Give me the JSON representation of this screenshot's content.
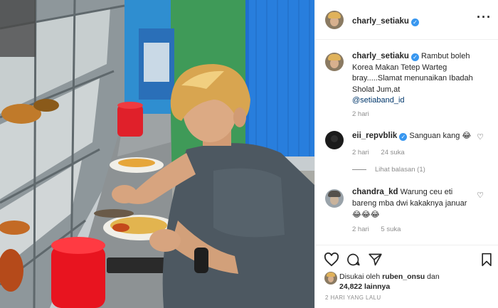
{
  "post": {
    "author": "charly_setiaku",
    "caption_text": "Rambut boleh Korea Makan Tetep Warteg bray.....Slamat menunaikan Ibadah Sholat Jum,at",
    "caption_mention": "@setiaband_id",
    "caption_time": "2 hari"
  },
  "comments": [
    {
      "user": "eii_repvblik",
      "text": "Sanguan kang",
      "emoji": "😂",
      "time": "2 hari",
      "likes": "24 suka",
      "replies_label": "Lihat balasan (1)"
    },
    {
      "user": "chandra_kd",
      "text": "Warung ceu eti bareng mba dwi kakaknya januar",
      "emoji": "😂😂😂",
      "time": "2 hari",
      "likes": "5 suka"
    }
  ],
  "likes": {
    "prefix": "Disukai oleh",
    "user": "ruben_onsu",
    "joiner": "dan",
    "count": "24,822",
    "suffix": "lainnya"
  },
  "post_date": "2 HARI YANG LALU",
  "icons": {
    "verified": "verified-badge-icon",
    "more": "more-options-icon",
    "like": "heart-icon",
    "comment": "comment-icon",
    "share": "paper-plane-icon",
    "save": "bookmark-icon"
  },
  "colors": {
    "verified_blue": "#3897f0",
    "mention": "#00376b",
    "muted": "#8e8e8e",
    "text": "#262626"
  }
}
